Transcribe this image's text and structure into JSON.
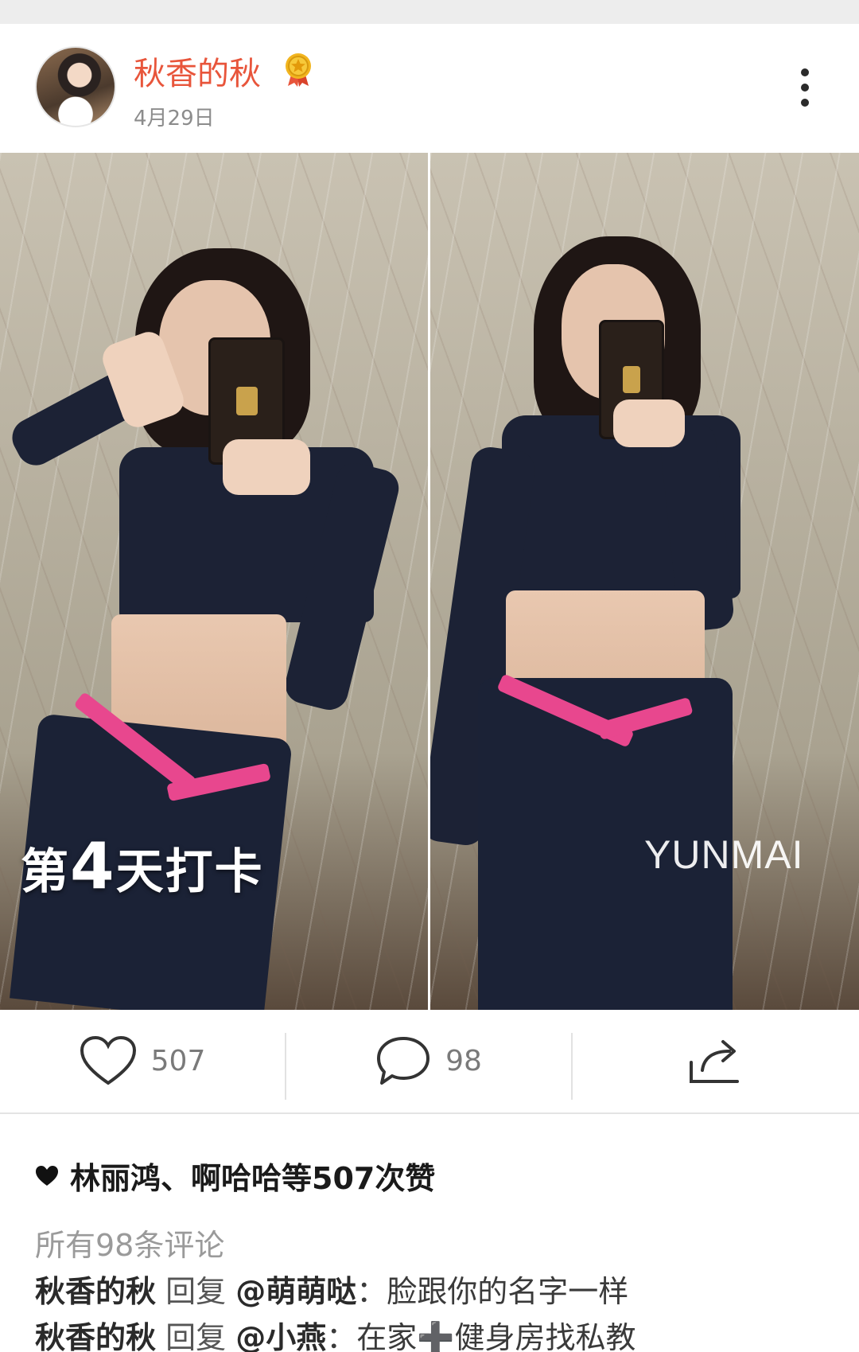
{
  "post": {
    "username": "秋香的秋",
    "date": "4月29日",
    "badge_icon": "gold-medal-icon",
    "accent_color": "#e8553b"
  },
  "photo": {
    "caption_prefix": "第",
    "caption_number": "4",
    "caption_suffix": "天打卡",
    "watermark": "YUNMAI"
  },
  "actions": {
    "like_count": "507",
    "comment_count": "98",
    "like_icon": "heart-outline-icon",
    "comment_icon": "speech-bubble-icon",
    "share_icon": "share-arrow-icon"
  },
  "likes_summary": "林丽鸿、啊哈哈等507次赞",
  "comments": {
    "all_label": "所有98条评论",
    "items": [
      {
        "author": "秋香的秋",
        "reply_word": "回复",
        "mention": "@萌萌哒",
        "text": "：脸跟你的名字一样"
      },
      {
        "author": "秋香的秋",
        "reply_word": "回复",
        "mention": "@小燕",
        "text": "：在家➕健身房找私教"
      }
    ]
  }
}
